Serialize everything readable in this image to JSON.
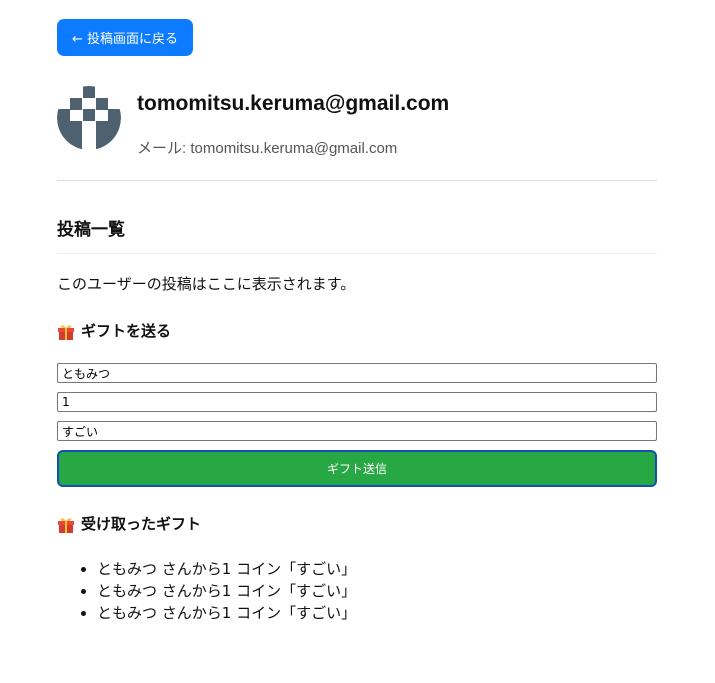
{
  "nav": {
    "back_label": "← 投稿画面に戻る"
  },
  "profile": {
    "display_name": "tomomitsu.keruma@gmail.com",
    "email_label": "メール:",
    "email": "tomomitsu.keruma@gmail.com",
    "avatar_icon": "identicon-avatar",
    "avatar_color": "#4d6170"
  },
  "posts": {
    "title": "投稿一覧",
    "empty_text": "このユーザーの投稿はここに表示されます。"
  },
  "gift_form": {
    "icon": "gift-icon",
    "title": "ギフトを送る",
    "sender_value": "ともみつ",
    "amount_value": "1",
    "message_value": "すごい",
    "submit_label": "ギフト送信",
    "submit_color": "#28a745"
  },
  "received": {
    "icon": "gift-icon",
    "title": "受け取ったギフト",
    "items": [
      {
        "text": "ともみつ さんから1 コイン「すごい」"
      },
      {
        "text": "ともみつ さんから1 コイン「すごい」"
      },
      {
        "text": "ともみつ さんから1 コイン「すごい」"
      }
    ]
  }
}
